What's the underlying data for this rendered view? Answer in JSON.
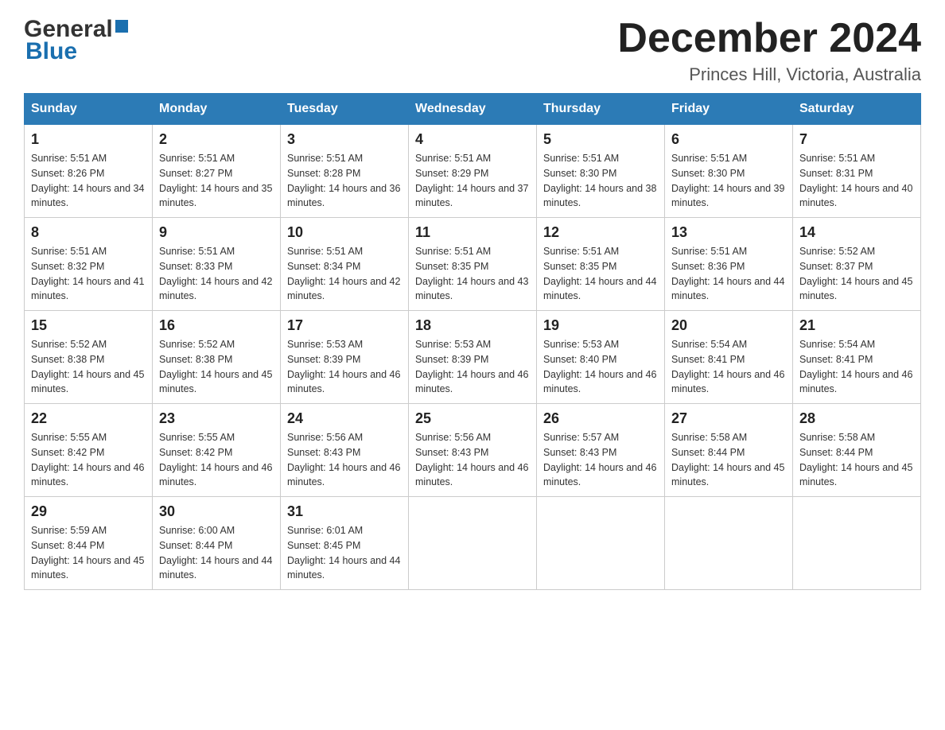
{
  "header": {
    "title": "December 2024",
    "subtitle": "Princes Hill, Victoria, Australia",
    "logo_line1": "General",
    "logo_line2": "Blue"
  },
  "days_of_week": [
    "Sunday",
    "Monday",
    "Tuesday",
    "Wednesday",
    "Thursday",
    "Friday",
    "Saturday"
  ],
  "weeks": [
    [
      {
        "day": "1",
        "sunrise": "5:51 AM",
        "sunset": "8:26 PM",
        "daylight": "14 hours and 34 minutes."
      },
      {
        "day": "2",
        "sunrise": "5:51 AM",
        "sunset": "8:27 PM",
        "daylight": "14 hours and 35 minutes."
      },
      {
        "day": "3",
        "sunrise": "5:51 AM",
        "sunset": "8:28 PM",
        "daylight": "14 hours and 36 minutes."
      },
      {
        "day": "4",
        "sunrise": "5:51 AM",
        "sunset": "8:29 PM",
        "daylight": "14 hours and 37 minutes."
      },
      {
        "day": "5",
        "sunrise": "5:51 AM",
        "sunset": "8:30 PM",
        "daylight": "14 hours and 38 minutes."
      },
      {
        "day": "6",
        "sunrise": "5:51 AM",
        "sunset": "8:30 PM",
        "daylight": "14 hours and 39 minutes."
      },
      {
        "day": "7",
        "sunrise": "5:51 AM",
        "sunset": "8:31 PM",
        "daylight": "14 hours and 40 minutes."
      }
    ],
    [
      {
        "day": "8",
        "sunrise": "5:51 AM",
        "sunset": "8:32 PM",
        "daylight": "14 hours and 41 minutes."
      },
      {
        "day": "9",
        "sunrise": "5:51 AM",
        "sunset": "8:33 PM",
        "daylight": "14 hours and 42 minutes."
      },
      {
        "day": "10",
        "sunrise": "5:51 AM",
        "sunset": "8:34 PM",
        "daylight": "14 hours and 42 minutes."
      },
      {
        "day": "11",
        "sunrise": "5:51 AM",
        "sunset": "8:35 PM",
        "daylight": "14 hours and 43 minutes."
      },
      {
        "day": "12",
        "sunrise": "5:51 AM",
        "sunset": "8:35 PM",
        "daylight": "14 hours and 44 minutes."
      },
      {
        "day": "13",
        "sunrise": "5:51 AM",
        "sunset": "8:36 PM",
        "daylight": "14 hours and 44 minutes."
      },
      {
        "day": "14",
        "sunrise": "5:52 AM",
        "sunset": "8:37 PM",
        "daylight": "14 hours and 45 minutes."
      }
    ],
    [
      {
        "day": "15",
        "sunrise": "5:52 AM",
        "sunset": "8:38 PM",
        "daylight": "14 hours and 45 minutes."
      },
      {
        "day": "16",
        "sunrise": "5:52 AM",
        "sunset": "8:38 PM",
        "daylight": "14 hours and 45 minutes."
      },
      {
        "day": "17",
        "sunrise": "5:53 AM",
        "sunset": "8:39 PM",
        "daylight": "14 hours and 46 minutes."
      },
      {
        "day": "18",
        "sunrise": "5:53 AM",
        "sunset": "8:39 PM",
        "daylight": "14 hours and 46 minutes."
      },
      {
        "day": "19",
        "sunrise": "5:53 AM",
        "sunset": "8:40 PM",
        "daylight": "14 hours and 46 minutes."
      },
      {
        "day": "20",
        "sunrise": "5:54 AM",
        "sunset": "8:41 PM",
        "daylight": "14 hours and 46 minutes."
      },
      {
        "day": "21",
        "sunrise": "5:54 AM",
        "sunset": "8:41 PM",
        "daylight": "14 hours and 46 minutes."
      }
    ],
    [
      {
        "day": "22",
        "sunrise": "5:55 AM",
        "sunset": "8:42 PM",
        "daylight": "14 hours and 46 minutes."
      },
      {
        "day": "23",
        "sunrise": "5:55 AM",
        "sunset": "8:42 PM",
        "daylight": "14 hours and 46 minutes."
      },
      {
        "day": "24",
        "sunrise": "5:56 AM",
        "sunset": "8:43 PM",
        "daylight": "14 hours and 46 minutes."
      },
      {
        "day": "25",
        "sunrise": "5:56 AM",
        "sunset": "8:43 PM",
        "daylight": "14 hours and 46 minutes."
      },
      {
        "day": "26",
        "sunrise": "5:57 AM",
        "sunset": "8:43 PM",
        "daylight": "14 hours and 46 minutes."
      },
      {
        "day": "27",
        "sunrise": "5:58 AM",
        "sunset": "8:44 PM",
        "daylight": "14 hours and 45 minutes."
      },
      {
        "day": "28",
        "sunrise": "5:58 AM",
        "sunset": "8:44 PM",
        "daylight": "14 hours and 45 minutes."
      }
    ],
    [
      {
        "day": "29",
        "sunrise": "5:59 AM",
        "sunset": "8:44 PM",
        "daylight": "14 hours and 45 minutes."
      },
      {
        "day": "30",
        "sunrise": "6:00 AM",
        "sunset": "8:44 PM",
        "daylight": "14 hours and 44 minutes."
      },
      {
        "day": "31",
        "sunrise": "6:01 AM",
        "sunset": "8:45 PM",
        "daylight": "14 hours and 44 minutes."
      },
      null,
      null,
      null,
      null
    ]
  ]
}
